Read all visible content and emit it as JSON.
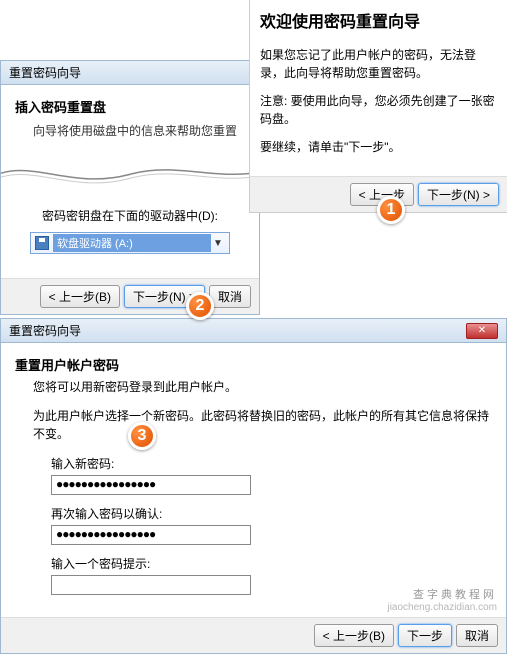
{
  "panel1": {
    "title": "重置密码向导",
    "heading": "插入密码重置盘",
    "subtext": "向导将使用磁盘中的信息来帮助您重置",
    "driver_label": "密码密钥盘在下面的驱动器中(D):",
    "dropdown_value": "软盘驱动器 (A:)",
    "btn_back": "< 上一步(B)",
    "btn_next": "下一步(N) >",
    "btn_cancel": "取消"
  },
  "panel2": {
    "title": "欢迎使用密码重置向导",
    "para1": "如果您忘记了此用户帐户的密码，无法登录，此向导将帮助您重置密码。",
    "para2": "注意: 要使用此向导，您必须先创建了一张密码盘。",
    "para3": "要继续，请单击\"下一步\"。",
    "btn_back": "< 上一步",
    "btn_next": "下一步(N) >"
  },
  "panel3": {
    "title": "重置密码向导",
    "heading": "重置用户帐户密码",
    "subtext": "您将可以用新密码登录到此用户帐户。",
    "instruction": "为此用户帐户选择一个新密码。此密码将替换旧的密码，此帐户的所有其它信息将保持不变。",
    "label_newpw": "输入新密码:",
    "value_newpw": "●●●●●●●●●●●●●●●●",
    "label_confirm": "再次输入密码以确认:",
    "value_confirm": "●●●●●●●●●●●●●●●●",
    "label_hint": "输入一个密码提示:",
    "value_hint": "",
    "btn_back": "< 上一步(B)",
    "btn_next": "下一步",
    "btn_cancel": "取消"
  },
  "badges": {
    "b1": "1",
    "b2": "2",
    "b3": "3"
  },
  "watermark": {
    "line1": "查字典教程网",
    "line2": "jiaocheng.chazidian.com"
  }
}
